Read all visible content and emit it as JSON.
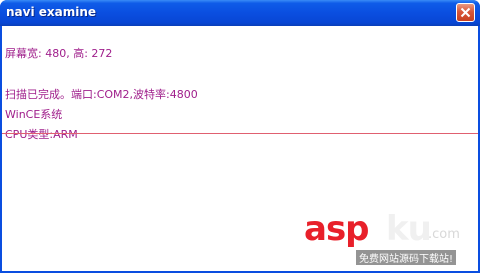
{
  "window": {
    "title": "navi examine",
    "close_icon": "close-icon"
  },
  "content": {
    "lines": [
      "屏幕宽: 480, 高: 272",
      "扫描已完成。端口:COM2,波特率:4800",
      "WinCE系统",
      "CPU类型:ARM"
    ],
    "text_color": "#a0208c",
    "divider_color": "#e06070"
  },
  "watermark": {
    "brand_asp": "asp",
    "brand_ku": "ku",
    "brand_com": ".com",
    "tagline": "免费网站源码下载站!",
    "brand_color": "#e8202a"
  },
  "colors": {
    "titlebar": "#0a4ee0",
    "close_button": "#d8573a",
    "background": "#ffffff"
  }
}
